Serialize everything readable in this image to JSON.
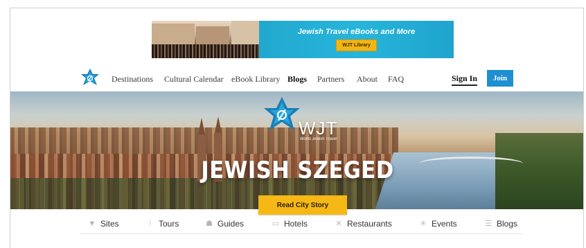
{
  "banner": {
    "tagline": "Jewish Travel eBooks and More",
    "button_label": "WJT Library"
  },
  "nav": {
    "items": [
      {
        "label": "Destinations"
      },
      {
        "label": "Cultural Calendar"
      },
      {
        "label": "eBook Library"
      },
      {
        "label": "Blogs"
      },
      {
        "label": "Partners"
      },
      {
        "label": "About"
      },
      {
        "label": "FAQ"
      }
    ],
    "signin_label": "Sign In",
    "join_label": "Join"
  },
  "hero": {
    "logo_text": "WJT",
    "logo_subtext": "World Jewish Travel",
    "title": "JEWISH SZEGED",
    "cta_label": "Read City Story"
  },
  "categories": [
    {
      "label": "Sites",
      "icon": "marker-icon"
    },
    {
      "label": "Tours",
      "icon": "footprints-icon"
    },
    {
      "label": "Guides",
      "icon": "guides-icon"
    },
    {
      "label": "Hotels",
      "icon": "bed-icon"
    },
    {
      "label": "Restaurants",
      "icon": "cutlery-icon"
    },
    {
      "label": "Events",
      "icon": "fireworks-icon"
    },
    {
      "label": "Blogs",
      "icon": "blog-icon"
    }
  ],
  "colors": {
    "accent_blue": "#1e8fd0",
    "cta_yellow": "#f5b814",
    "banner_blue": "#27b5db"
  }
}
